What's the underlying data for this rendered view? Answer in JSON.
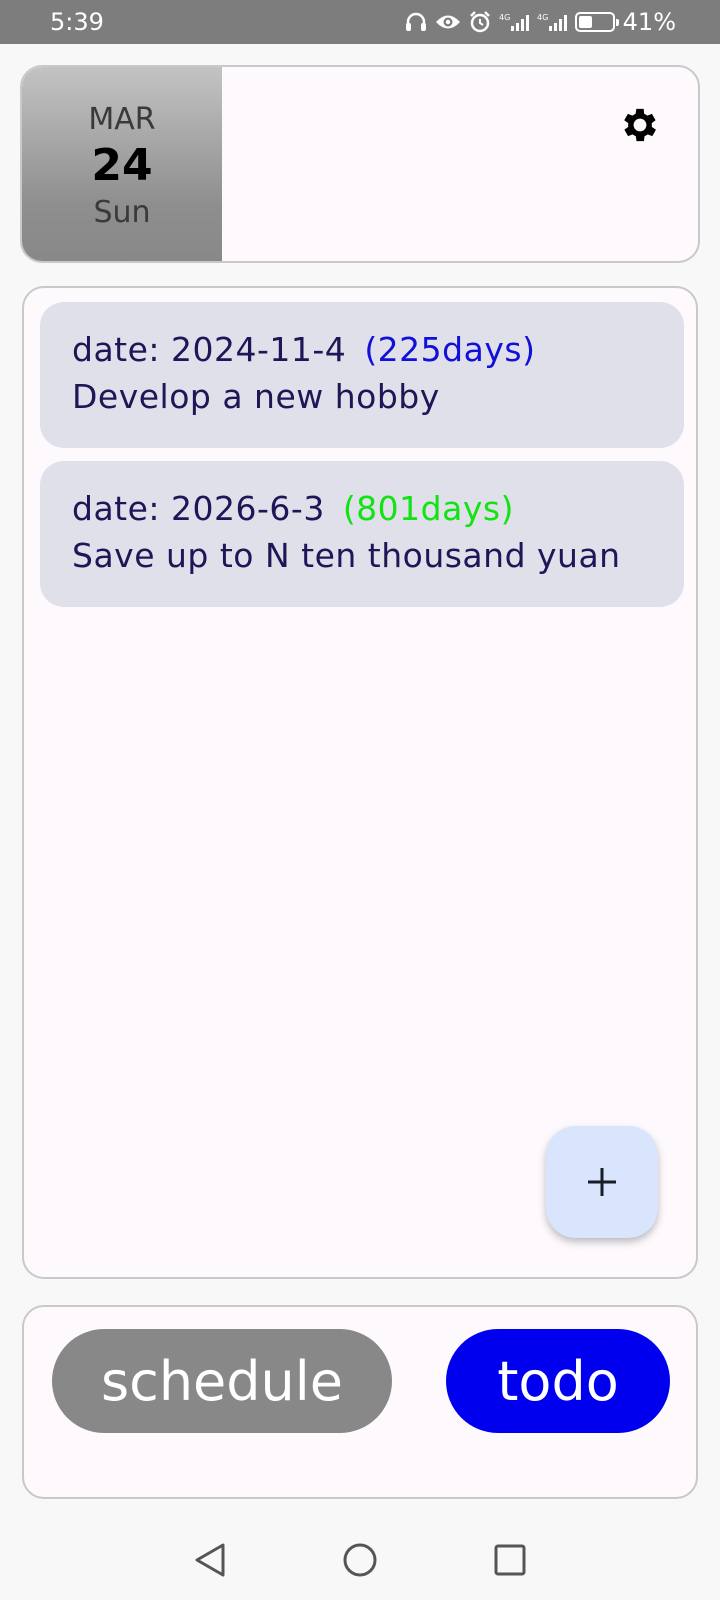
{
  "status_bar": {
    "time": "5:39",
    "battery_percent": "41%",
    "battery_level": 0.41,
    "icons": [
      "headphones-icon",
      "eye-icon",
      "alarm-icon",
      "signal-4g-icon",
      "signal-4g-icon",
      "battery-icon"
    ]
  },
  "header": {
    "month": "MAR",
    "day": "24",
    "weekday": "Sun",
    "settings_icon": "gear-icon"
  },
  "todos": [
    {
      "date_label": "date: 2024-11-4",
      "days_label": "(225days)",
      "days_color": "#1010d8",
      "title": "Develop a new hobby"
    },
    {
      "date_label": "date: 2026-6-3",
      "days_label": "(801days)",
      "days_color": "#12e312",
      "title": "Save up to N ten thousand yuan"
    }
  ],
  "fab": {
    "label": "+",
    "icon": "plus-icon"
  },
  "tabs": {
    "schedule_label": "schedule",
    "todo_label": "todo",
    "active": "todo",
    "colors": {
      "inactive": "#888888",
      "active": "#0000ee"
    }
  },
  "nav": {
    "icons": [
      "back-icon",
      "home-icon",
      "recents-icon"
    ]
  }
}
